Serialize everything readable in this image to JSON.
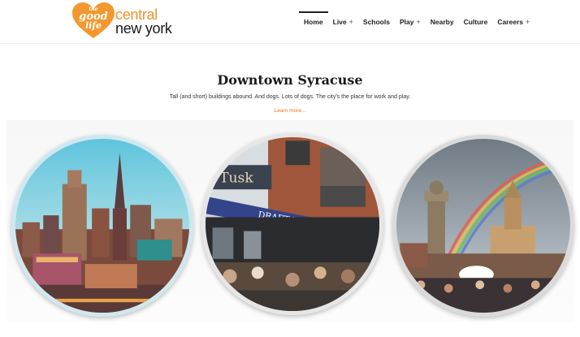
{
  "logo": {
    "the": "the",
    "good": "good",
    "life": "life",
    "central": "central",
    "new_york": "new york",
    "colors": {
      "heart": "#f3972f",
      "central": "#f0902a",
      "new_york": "#1a1a1a"
    }
  },
  "nav": {
    "items": [
      {
        "label": "Home",
        "active": true,
        "has_submenu": false
      },
      {
        "label": "Live",
        "active": false,
        "has_submenu": true
      },
      {
        "label": "Schools",
        "active": false,
        "has_submenu": false
      },
      {
        "label": "Play",
        "active": false,
        "has_submenu": true
      },
      {
        "label": "Nearby",
        "active": false,
        "has_submenu": false
      },
      {
        "label": "Culture",
        "active": false,
        "has_submenu": false
      },
      {
        "label": "Careers",
        "active": false,
        "has_submenu": true
      }
    ],
    "submenu_glyph": "+"
  },
  "hero": {
    "title": "Downtown Syracuse",
    "subtitle": "Tall (and short) buildings abound. And dogs. Lots of dogs. The city's the place for work and play.",
    "link": "Learn more...",
    "link_color": "#e07a1f"
  },
  "gallery": {
    "images": [
      {
        "name": "skyline-photo"
      },
      {
        "name": "street-cafe-photo",
        "sign_tusk": "Tusk",
        "sign_awning": "DRAFT BEER"
      },
      {
        "name": "rainbow-square-photo"
      }
    ]
  }
}
